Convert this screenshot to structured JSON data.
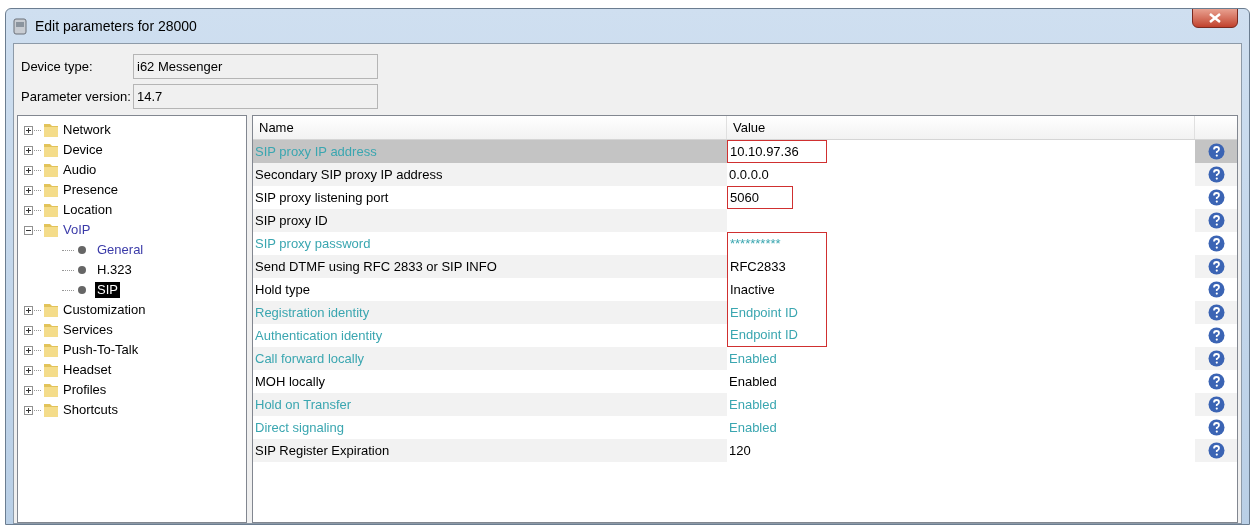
{
  "window": {
    "title": "Edit parameters for 28000"
  },
  "info": [
    {
      "label": "Device type:",
      "value": "i62 Messenger"
    },
    {
      "label": "Parameter version:",
      "value": "14.7"
    }
  ],
  "tree": [
    {
      "label": "Network",
      "expanded": false,
      "selected": false,
      "visited": false
    },
    {
      "label": "Device",
      "expanded": false,
      "selected": false,
      "visited": false
    },
    {
      "label": "Audio",
      "expanded": false,
      "selected": false,
      "visited": false
    },
    {
      "label": "Presence",
      "expanded": false,
      "selected": false,
      "visited": false
    },
    {
      "label": "Location",
      "expanded": false,
      "selected": false,
      "visited": false
    },
    {
      "label": "VoIP",
      "expanded": true,
      "selected": false,
      "visited": true,
      "children": [
        {
          "label": "General",
          "selected": false,
          "visited": true
        },
        {
          "label": "H.323",
          "selected": false,
          "visited": false
        },
        {
          "label": "SIP",
          "selected": true,
          "visited": false
        }
      ]
    },
    {
      "label": "Customization",
      "expanded": false,
      "selected": false,
      "visited": false
    },
    {
      "label": "Services",
      "expanded": false,
      "selected": false,
      "visited": false
    },
    {
      "label": "Push-To-Talk",
      "expanded": false,
      "selected": false,
      "visited": false
    },
    {
      "label": "Headset",
      "expanded": false,
      "selected": false,
      "visited": false
    },
    {
      "label": "Profiles",
      "expanded": false,
      "selected": false,
      "visited": false
    },
    {
      "label": "Shortcuts",
      "expanded": false,
      "selected": false,
      "visited": false
    }
  ],
  "table": {
    "columns": [
      "Name",
      "Value"
    ],
    "rows": [
      {
        "name": "SIP proxy IP address",
        "value": "10.10.97.36",
        "modified": true,
        "selected": true,
        "outlined": true
      },
      {
        "name": "Secondary SIP proxy IP address",
        "value": "0.0.0.0",
        "modified": false,
        "selected": false,
        "outlined": false
      },
      {
        "name": "SIP proxy listening port",
        "value": "5060",
        "modified": false,
        "selected": false,
        "outlined": true
      },
      {
        "name": "SIP proxy ID",
        "modified": false,
        "selected": false,
        "outlined": false
      },
      {
        "name": "SIP proxy password",
        "value": "**********",
        "modified": true,
        "selected": false,
        "outlined": true
      },
      {
        "name": "Send DTMF using RFC 2833 or SIP INFO",
        "value": "RFC2833",
        "modified": false,
        "selected": false,
        "outlined": true
      },
      {
        "name": "Hold type",
        "value": "Inactive",
        "modified": false,
        "selected": false,
        "outlined": true
      },
      {
        "name": "Registration identity",
        "value": "Endpoint ID",
        "modified": true,
        "selected": false,
        "outlined": true
      },
      {
        "name": "Authentication identity",
        "value": "Endpoint ID",
        "modified": true,
        "selected": false,
        "outlined": true
      },
      {
        "name": "Call forward locally",
        "value": "Enabled",
        "modified": true,
        "selected": false,
        "outlined": false
      },
      {
        "name": "MOH locally",
        "value": "Enabled",
        "modified": false,
        "selected": false,
        "outlined": false
      },
      {
        "name": "Hold on Transfer",
        "value": "Enabled",
        "modified": true,
        "selected": false,
        "outlined": false
      },
      {
        "name": "Direct signaling",
        "value": "Enabled",
        "modified": true,
        "selected": false,
        "outlined": false
      },
      {
        "name": "SIP Register Expiration",
        "value": "120",
        "modified": false,
        "selected": false,
        "outlined": false
      }
    ]
  }
}
